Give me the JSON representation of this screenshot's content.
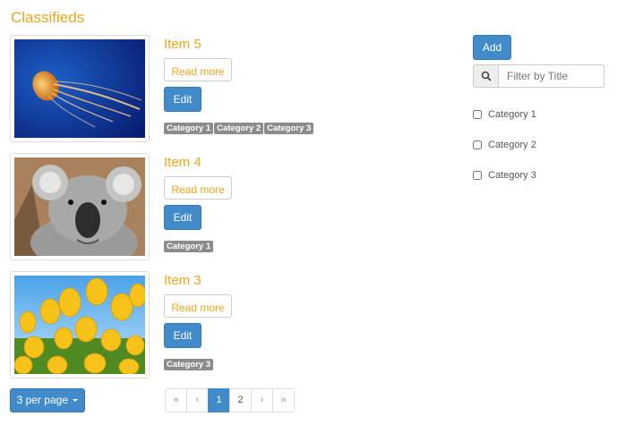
{
  "header": {
    "title": "Classifieds"
  },
  "items": [
    {
      "name": "Item 5",
      "read_more": "Read more",
      "edit": "Edit",
      "image": "jellyfish-photo",
      "categories": [
        "Category 1",
        "Category 2",
        "Category 3"
      ]
    },
    {
      "name": "Item 4",
      "read_more": "Read more",
      "edit": "Edit",
      "image": "koala-photo",
      "categories": [
        "Category 1"
      ]
    },
    {
      "name": "Item 3",
      "read_more": "Read more",
      "edit": "Edit",
      "image": "tulips-photo",
      "categories": [
        "Category 3"
      ]
    }
  ],
  "sidebar": {
    "add_label": "Add",
    "search": {
      "placeholder": "Filter by Title",
      "value": "",
      "icon": "search-icon"
    },
    "filters": [
      {
        "label": "Category 1",
        "checked": false
      },
      {
        "label": "Category 2",
        "checked": false
      },
      {
        "label": "Category 3",
        "checked": false
      }
    ]
  },
  "footer": {
    "per_page_label": "3 per page",
    "pagination": {
      "first": "«",
      "prev": "‹",
      "pages": [
        "1",
        "2"
      ],
      "current": "1",
      "next": "›",
      "last": "»"
    }
  },
  "colors": {
    "accent": "#f0a51a",
    "primary": "#428bca",
    "label_bg": "#8c8c8c"
  }
}
